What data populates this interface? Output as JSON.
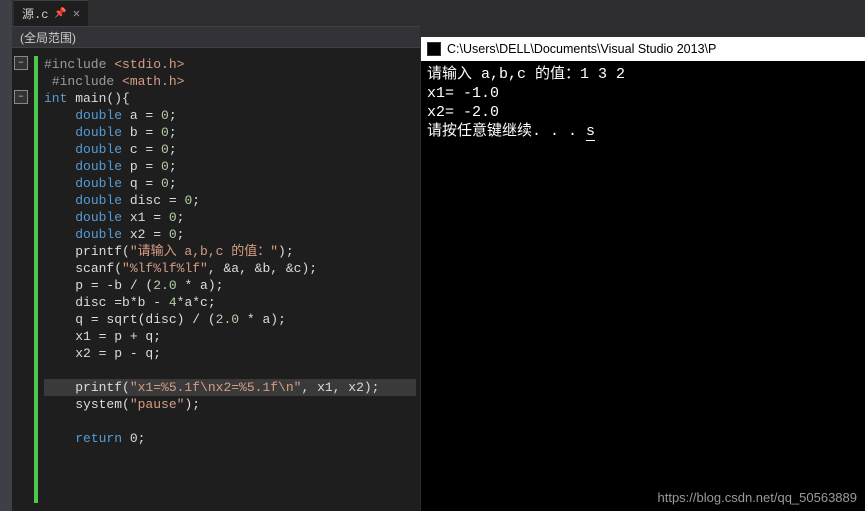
{
  "tab": {
    "filename": "源.c"
  },
  "scope": {
    "label": "(全局范围)"
  },
  "code": {
    "include1_kw": "#include",
    "include1_file": "<stdio.h>",
    "include2_kw": "#include",
    "include2_file": "<math.h>",
    "main_type": "int",
    "main_name": " main(){",
    "d_kw": "double",
    "decl_a": " a = ",
    "decl_a_v": "0",
    "semi": ";",
    "decl_b": " b = ",
    "decl_b_v": "0",
    "decl_c": " c = ",
    "decl_c_v": "0",
    "decl_p": " p = ",
    "decl_p_v": "0",
    "decl_q": " q = ",
    "decl_q_v": "0",
    "decl_disc": " disc = ",
    "decl_disc_v": "0",
    "decl_x1": " x1 = ",
    "decl_x1_v": "0",
    "decl_x2": " x2 = ",
    "decl_x2_v": "0",
    "printf1a": "printf(",
    "printf1s": "\"请输入 a,b,c 的值：\"",
    "printf1b": ");",
    "scanf_a": "scanf(",
    "scanf_s": "\"%lf%lf%lf\"",
    "scanf_b": ", &a, &b, &c);",
    "p_calc": "p = -b / (",
    "p_calc_n": "2.0",
    "p_calc2": " * a);",
    "disc_calc": "disc =b*b - ",
    "disc_n": "4",
    "disc_calc2": "*a*c;",
    "q_calc": "q = sqrt(disc) / (",
    "q_n": "2.0",
    "q_calc2": " * a);",
    "x1calc": "x1 = p + q;",
    "x2calc": "x2 = p - q;",
    "printf2a": "printf(",
    "printf2s": "\"x1=%5.1f\\nx2=%5.1f\\n\"",
    "printf2b": ", x1, x2);",
    "system_a": "system(",
    "system_s": "\"pause\"",
    "system_b": ");",
    "ret_kw": "return",
    "ret_v": " 0",
    "ret_s": ";"
  },
  "console": {
    "title": "C:\\Users\\DELL\\Documents\\Visual Studio 2013\\P",
    "line1": "请输入 a,b,c 的值：1 3 2",
    "line2": "x1= -1.0",
    "line3": "x2= -2.0",
    "line4": "请按任意键继续. . . ",
    "line4_char": "s"
  },
  "watermark": "https://blog.csdn.net/qq_50563889"
}
